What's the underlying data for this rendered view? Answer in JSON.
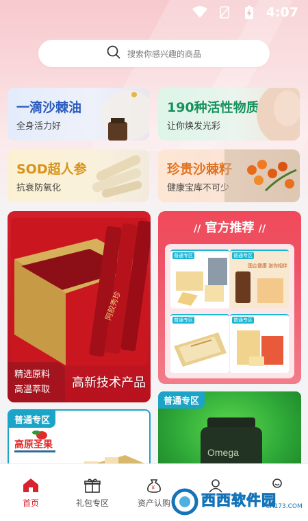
{
  "status_bar": {
    "time": "4:07"
  },
  "search": {
    "placeholder": "搜索你感兴趣的商品"
  },
  "categories": [
    {
      "title": "一滴沙棘油",
      "subtitle": "全身活力好"
    },
    {
      "title": "190种活性物质",
      "subtitle": "让你焕发光彩"
    },
    {
      "title": "SOD超人参",
      "subtitle": "抗衰防氧化"
    },
    {
      "title": "珍贵沙棘籽",
      "subtitle": "健康宝库不可少"
    }
  ],
  "promo": {
    "left_tag_line1": "精选原料",
    "left_tag_line2": "高温萃取",
    "right_text": "高新技术产品",
    "box_text": "阿胶秀珍"
  },
  "official": {
    "title": "官方推荐",
    "mini_badge": "普通专区",
    "mini_text_2": "国企健康 滋你相伴"
  },
  "zones": {
    "left_label": "普通专区",
    "right_label": "普通专区",
    "left_brand": "高原圣果",
    "right_product": "Omega"
  },
  "tabs": [
    {
      "label": "首页",
      "icon": "home-icon"
    },
    {
      "label": "礼包专区",
      "icon": "gift-icon"
    },
    {
      "label": "资产认购",
      "icon": "money-bag-icon"
    },
    {
      "label": "",
      "icon": "user-icon"
    },
    {
      "label": "",
      "icon": "profile-icon"
    }
  ],
  "watermark": {
    "text": "西西软件园",
    "url": "CR173.COM"
  },
  "colors": {
    "accent": "#d8232f",
    "zone": "#1ba3c8"
  }
}
